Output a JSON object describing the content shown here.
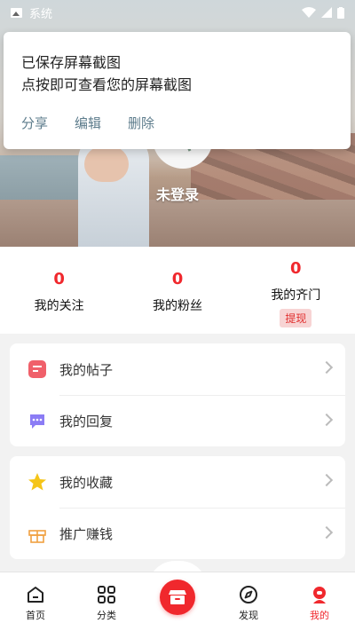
{
  "status_bar": {
    "app_label": "系统",
    "icons": [
      "image-icon",
      "wifi-icon",
      "signal-icon",
      "battery-icon"
    ]
  },
  "notification": {
    "title": "已保存屏幕截图",
    "body": "点按即可查看您的屏幕截图",
    "actions": [
      "分享",
      "编辑",
      "删除"
    ]
  },
  "profile": {
    "username": "未登录"
  },
  "stats": [
    {
      "value": "0",
      "label": "我的关注"
    },
    {
      "value": "0",
      "label": "我的粉丝"
    },
    {
      "value": "0",
      "label": "我的齐门",
      "action": "提现"
    }
  ],
  "menu": {
    "group1": [
      {
        "label": "我的帖子",
        "icon": "post-icon"
      },
      {
        "label": "我的回复",
        "icon": "reply-icon"
      }
    ],
    "group2": [
      {
        "label": "我的收藏",
        "icon": "star-icon"
      },
      {
        "label": "推广赚钱",
        "icon": "gift-icon"
      }
    ]
  },
  "tabbar": {
    "tabs": [
      {
        "label": "首页",
        "icon": "home-icon"
      },
      {
        "label": "分类",
        "icon": "grid-icon"
      },
      {
        "label": "",
        "icon": "shop-icon"
      },
      {
        "label": "发现",
        "icon": "compass-icon"
      },
      {
        "label": "我的",
        "icon": "profile-icon"
      }
    ],
    "active": "我的",
    "accent": "#f0282d"
  }
}
